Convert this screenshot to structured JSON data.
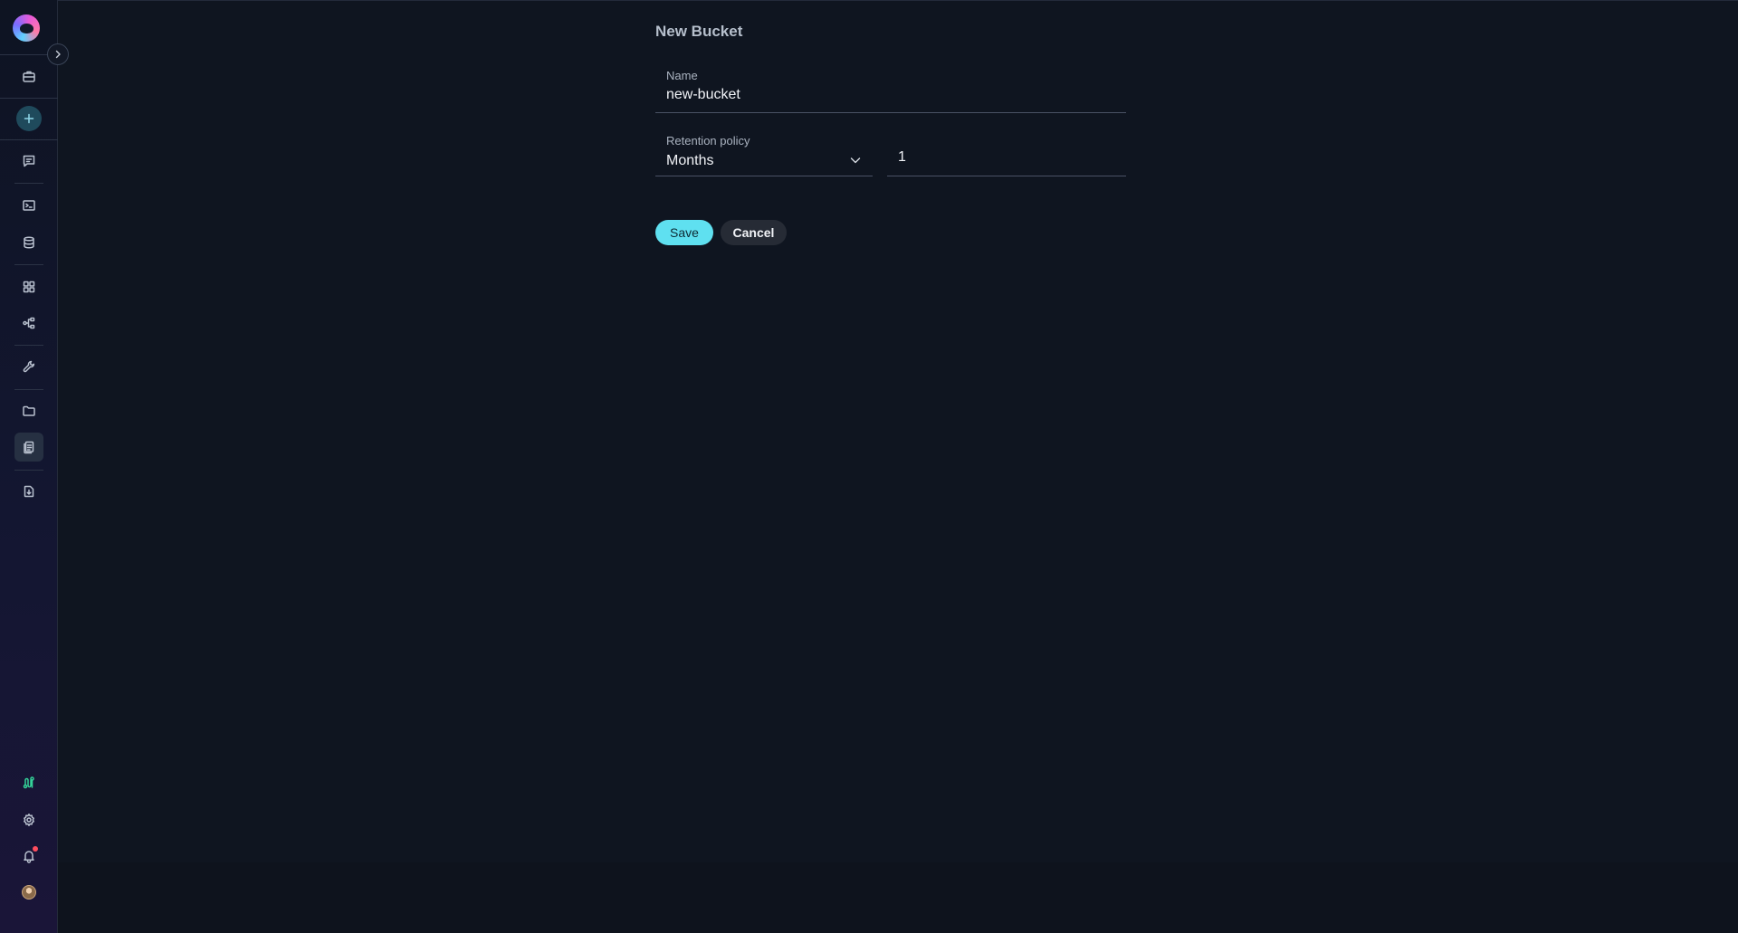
{
  "page": {
    "title": "New Bucket"
  },
  "form": {
    "name_label": "Name",
    "name_value": "new-bucket",
    "retention_label": "Retention policy",
    "retention_selected": "Months",
    "retention_amount": "1"
  },
  "buttons": {
    "save": "Save",
    "cancel": "Cancel"
  },
  "sidebar": {
    "items": [
      {
        "name": "briefcase-icon"
      },
      {
        "name": "plus-icon"
      },
      {
        "name": "chat-icon"
      },
      {
        "name": "terminal-icon"
      },
      {
        "name": "database-icon"
      },
      {
        "name": "grid-icon"
      },
      {
        "name": "workflow-icon"
      },
      {
        "name": "wrench-icon"
      },
      {
        "name": "folder-icon"
      },
      {
        "name": "documents-icon"
      },
      {
        "name": "file-import-icon"
      },
      {
        "name": "release-icon"
      },
      {
        "name": "gear-icon"
      },
      {
        "name": "bell-icon"
      },
      {
        "name": "avatar"
      }
    ]
  },
  "colors": {
    "accent": "#5fe0f0",
    "background": "#0f1520",
    "notification": "#ff4d5e",
    "release_icon": "#34d399"
  }
}
